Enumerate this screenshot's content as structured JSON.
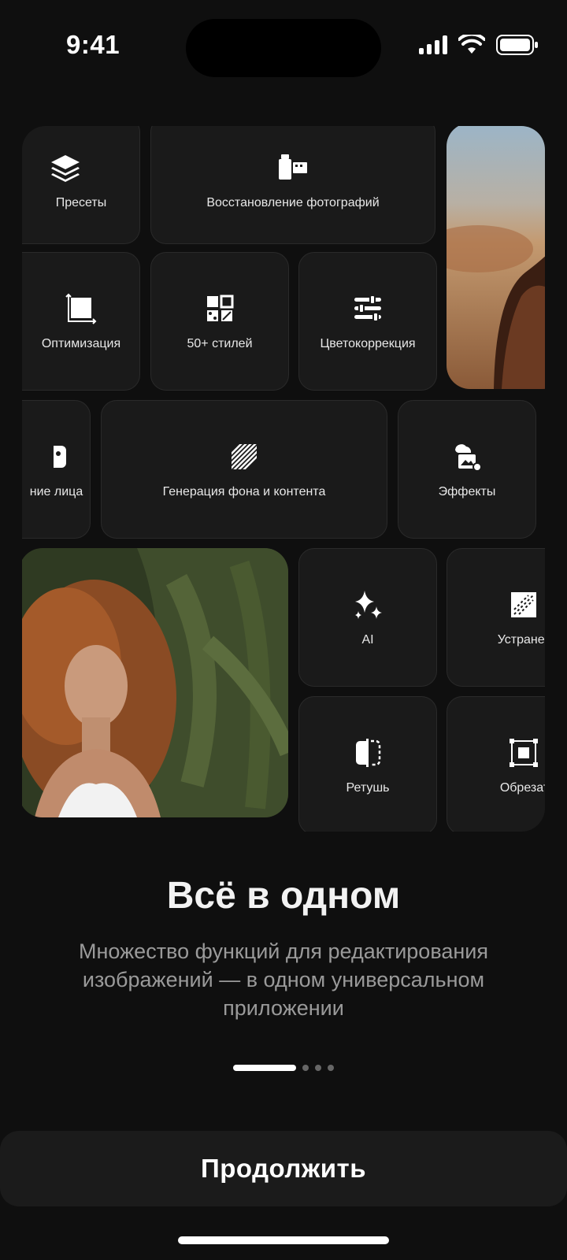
{
  "status_bar": {
    "time": "9:41"
  },
  "features": {
    "presets": "Пресеты",
    "restore": "Восстановление фотографий",
    "optimize": "Оптимизация",
    "styles": "50+ стилей",
    "color": "Цветокоррекция",
    "face": "ние лица",
    "generation": "Генерация фона и контента",
    "effects": "Эффекты",
    "ai": "AI",
    "remove": "Устранение",
    "retouch": "Ретушь",
    "crop": "Обрезать ("
  },
  "onboarding": {
    "title": "Всё в одном",
    "subtitle": "Множество функций для редактирования изображений — в одном универсальном приложении",
    "page_count": 4,
    "active_page": 1
  },
  "cta": {
    "label": "Продолжить"
  },
  "colors": {
    "background": "#0f0f0f",
    "tile": "#1a1a1a",
    "accent": "#ffffff"
  }
}
